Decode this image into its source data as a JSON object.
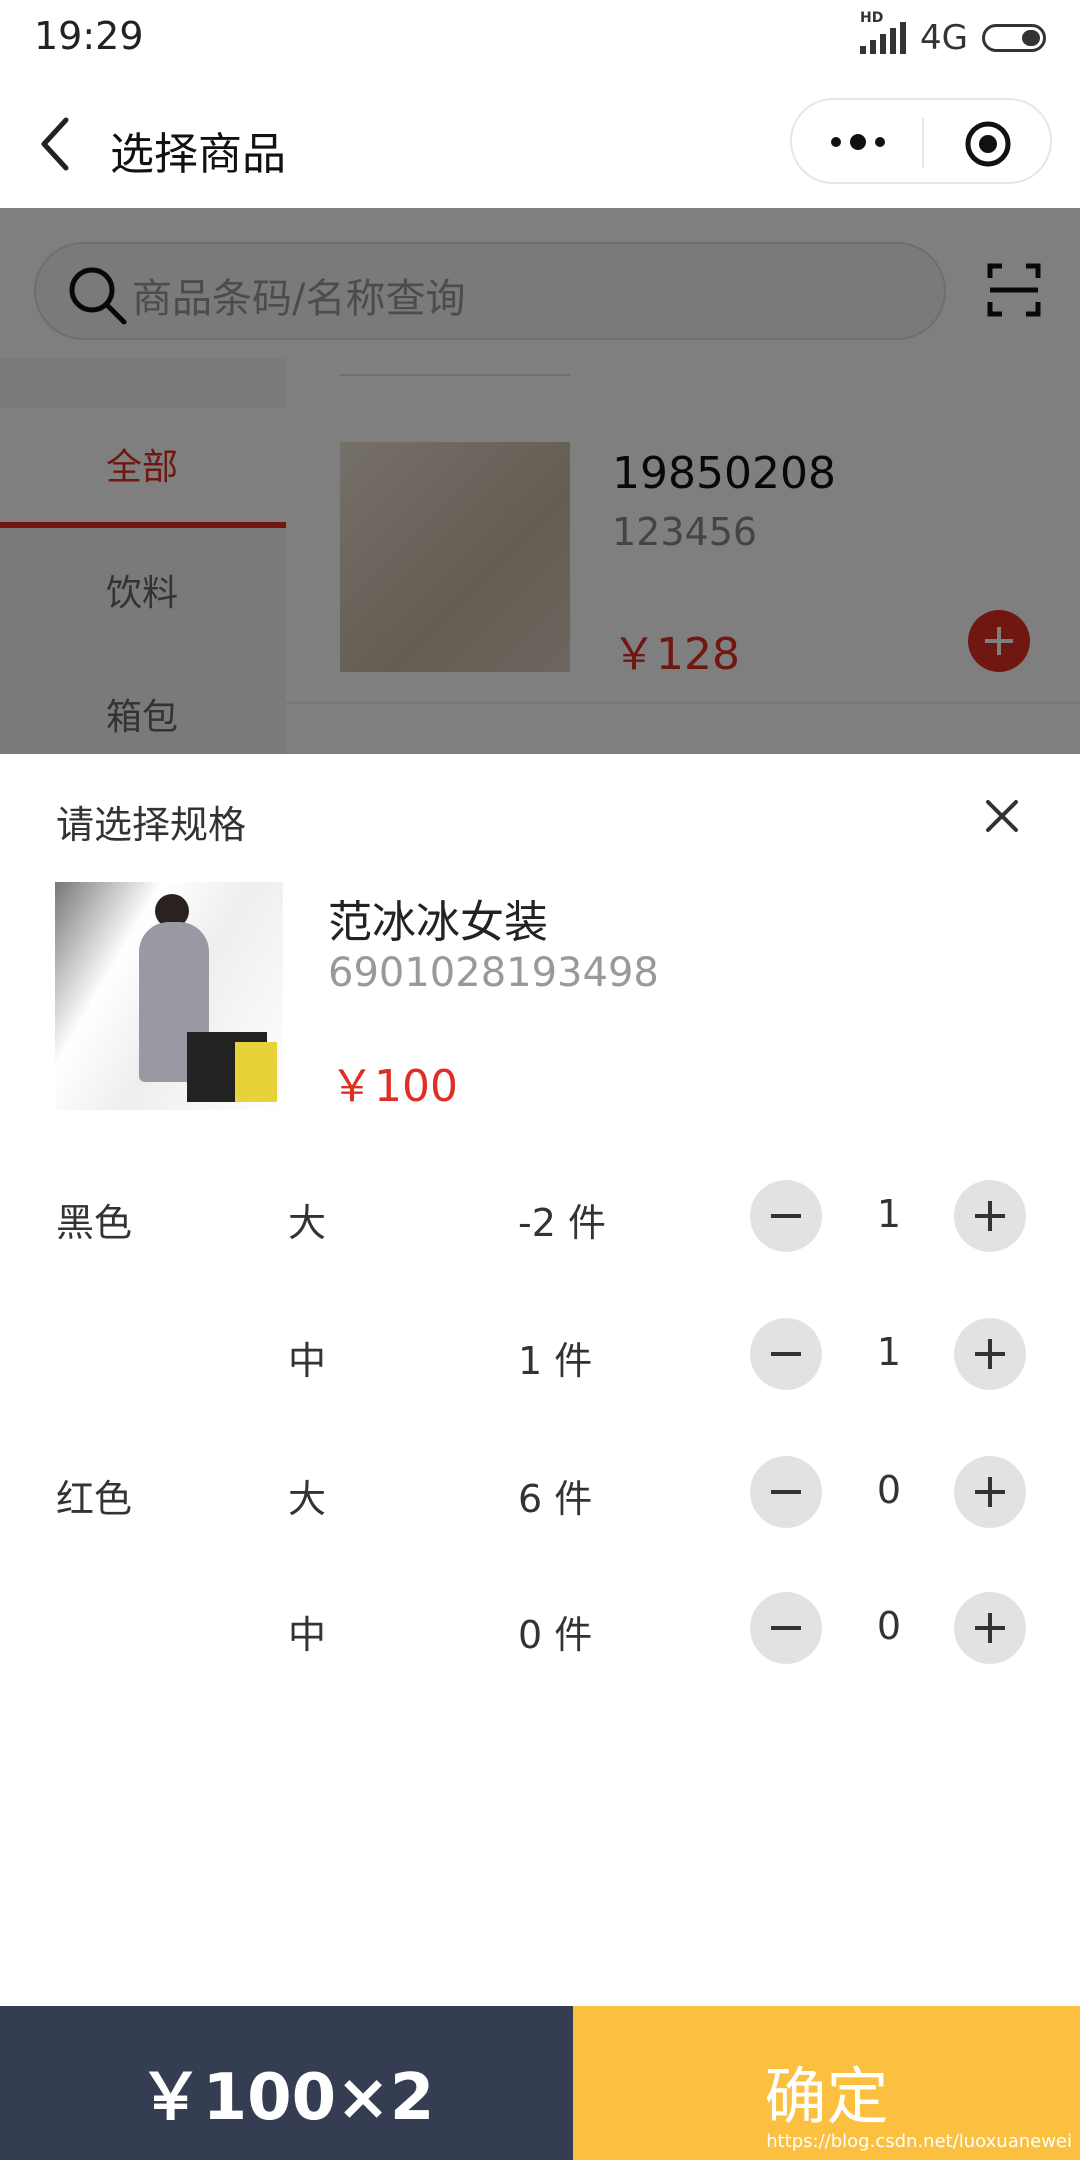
{
  "status_bar": {
    "time": "19:29",
    "hd": "HD",
    "network": "4G"
  },
  "nav": {
    "title": "选择商品"
  },
  "search": {
    "placeholder": "商品条码/名称查询"
  },
  "sidebar": {
    "categories": [
      {
        "label": "全部",
        "active": true
      },
      {
        "label": "饮料",
        "active": false
      },
      {
        "label": "箱包",
        "active": false
      }
    ]
  },
  "background_product": {
    "name": "19850208",
    "code": "123456",
    "price": "￥128"
  },
  "sheet": {
    "title": "请选择规格",
    "product": {
      "name": "范冰冰女装",
      "code": "6901028193498",
      "price": "￥100"
    },
    "variants": [
      {
        "color": "黑色",
        "size": "大",
        "stock": "-2 件",
        "qty": "1"
      },
      {
        "color": "",
        "size": "中",
        "stock": "1 件",
        "qty": "1"
      },
      {
        "color": "红色",
        "size": "大",
        "stock": "6 件",
        "qty": "0"
      },
      {
        "color": "",
        "size": "中",
        "stock": "0 件",
        "qty": "0"
      }
    ]
  },
  "bottom": {
    "total": "￥100×2",
    "confirm_label": "确定",
    "watermark": "https://blog.csdn.net/luoxuanewei"
  },
  "colors": {
    "accent_red": "#e02e24",
    "total_bar": "#353d52",
    "confirm": "#fbc03f"
  }
}
